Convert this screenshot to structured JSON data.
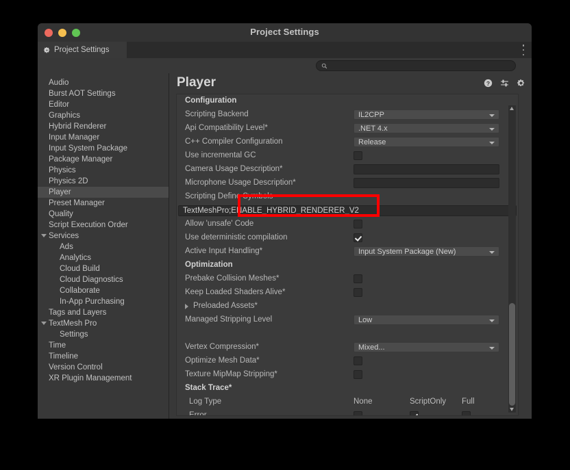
{
  "window": {
    "title": "Project Settings",
    "traffic_lights": [
      "close-red",
      "minimize-yellow",
      "maximize-green"
    ]
  },
  "tab": {
    "label": "Project Settings",
    "icon": "gear-icon",
    "accent_color": "#2d7fd3",
    "menu_icon": "kebab-menu-icon"
  },
  "search": {
    "placeholder": "",
    "value": "",
    "icon": "search-icon"
  },
  "sidebar": {
    "items": [
      {
        "label": "Audio",
        "level": 0,
        "selected": false,
        "expandable": false
      },
      {
        "label": "Burst AOT Settings",
        "level": 0,
        "selected": false,
        "expandable": false
      },
      {
        "label": "Editor",
        "level": 0,
        "selected": false,
        "expandable": false
      },
      {
        "label": "Graphics",
        "level": 0,
        "selected": false,
        "expandable": false
      },
      {
        "label": "Hybrid Renderer",
        "level": 0,
        "selected": false,
        "expandable": false
      },
      {
        "label": "Input Manager",
        "level": 0,
        "selected": false,
        "expandable": false
      },
      {
        "label": "Input System Package",
        "level": 0,
        "selected": false,
        "expandable": false
      },
      {
        "label": "Package Manager",
        "level": 0,
        "selected": false,
        "expandable": false
      },
      {
        "label": "Physics",
        "level": 0,
        "selected": false,
        "expandable": false
      },
      {
        "label": "Physics 2D",
        "level": 0,
        "selected": false,
        "expandable": false
      },
      {
        "label": "Player",
        "level": 0,
        "selected": true,
        "expandable": false
      },
      {
        "label": "Preset Manager",
        "level": 0,
        "selected": false,
        "expandable": false
      },
      {
        "label": "Quality",
        "level": 0,
        "selected": false,
        "expandable": false
      },
      {
        "label": "Script Execution Order",
        "level": 0,
        "selected": false,
        "expandable": false
      },
      {
        "label": "Services",
        "level": 0,
        "selected": false,
        "expandable": true
      },
      {
        "label": "Ads",
        "level": 1,
        "selected": false,
        "expandable": false
      },
      {
        "label": "Analytics",
        "level": 1,
        "selected": false,
        "expandable": false
      },
      {
        "label": "Cloud Build",
        "level": 1,
        "selected": false,
        "expandable": false
      },
      {
        "label": "Cloud Diagnostics",
        "level": 1,
        "selected": false,
        "expandable": false
      },
      {
        "label": "Collaborate",
        "level": 1,
        "selected": false,
        "expandable": false
      },
      {
        "label": "In-App Purchasing",
        "level": 1,
        "selected": false,
        "expandable": false
      },
      {
        "label": "Tags and Layers",
        "level": 0,
        "selected": false,
        "expandable": false
      },
      {
        "label": "TextMesh Pro",
        "level": 0,
        "selected": false,
        "expandable": true
      },
      {
        "label": "Settings",
        "level": 1,
        "selected": false,
        "expandable": false
      },
      {
        "label": "Time",
        "level": 0,
        "selected": false,
        "expandable": false
      },
      {
        "label": "Timeline",
        "level": 0,
        "selected": false,
        "expandable": false
      },
      {
        "label": "Version Control",
        "level": 0,
        "selected": false,
        "expandable": false
      },
      {
        "label": "XR Plugin Management",
        "level": 0,
        "selected": false,
        "expandable": false
      }
    ]
  },
  "main": {
    "title": "Player",
    "header_icons": [
      "help-icon",
      "preset-icon",
      "gear-icon"
    ],
    "sections": [
      {
        "heading": "Configuration",
        "rows": [
          {
            "label": "Scripting Backend",
            "control": "dropdown",
            "value": "IL2CPP"
          },
          {
            "label": "Api Compatibility Level*",
            "control": "dropdown",
            "value": ".NET 4.x"
          },
          {
            "label": "C++ Compiler Configuration",
            "control": "dropdown",
            "value": "Release"
          },
          {
            "label": "Use incremental GC",
            "control": "checkbox",
            "checked": false
          },
          {
            "label": "Camera Usage Description*",
            "control": "textfield",
            "value": ""
          },
          {
            "label": "Microphone Usage Description*",
            "control": "textfield",
            "value": ""
          },
          {
            "label": "Scripting Define Symbols",
            "control": "none"
          },
          {
            "label": "",
            "control": "textfield-wide",
            "value": "TextMeshPro;ENABLE_HYBRID_RENDERER_V2",
            "highlighted": true
          },
          {
            "label": "Allow 'unsafe' Code",
            "control": "checkbox",
            "checked": false
          },
          {
            "label": "Use deterministic compilation",
            "control": "checkbox",
            "checked": true
          },
          {
            "label": "Active Input Handling*",
            "control": "dropdown",
            "value": "Input System Package (New)"
          }
        ]
      },
      {
        "heading": "Optimization",
        "rows": [
          {
            "label": "Prebake Collision Meshes*",
            "control": "checkbox",
            "checked": false
          },
          {
            "label": "Keep Loaded Shaders Alive*",
            "control": "checkbox",
            "checked": false
          },
          {
            "label": "Preloaded Assets*",
            "control": "foldout"
          },
          {
            "label": "Managed Stripping Level",
            "control": "dropdown",
            "value": "Low"
          },
          {
            "label": "",
            "control": "spacer"
          },
          {
            "label": "Vertex Compression*",
            "control": "dropdown",
            "value": "Mixed..."
          },
          {
            "label": "Optimize Mesh Data*",
            "control": "checkbox",
            "checked": false
          },
          {
            "label": "Texture MipMap Stripping*",
            "control": "checkbox",
            "checked": false
          }
        ]
      },
      {
        "heading": "Stack Trace*",
        "columns": [
          "None",
          "ScriptOnly",
          "Full"
        ],
        "log_type_label": "Log Type",
        "rows": [
          {
            "label": "Error",
            "control": "radio-row",
            "selected_column": "ScriptOnly"
          }
        ]
      }
    ]
  },
  "annotation": {
    "color": "#fe0000",
    "target": "scripting-define-symbols-field"
  },
  "scrollbar": {
    "up_icon": "scroll-up-arrow",
    "down_icon": "scroll-down-arrow"
  }
}
